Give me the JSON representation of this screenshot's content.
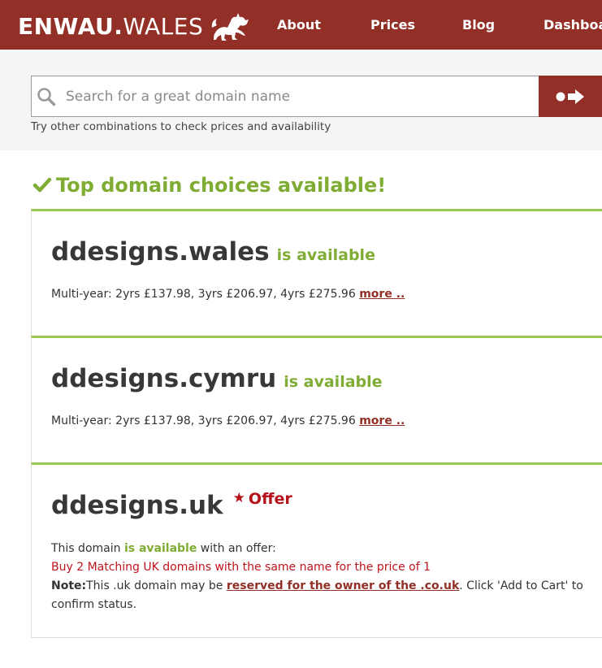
{
  "header": {
    "logo_bold": "ENWAU.",
    "logo_light": "WALES",
    "nav": [
      "About",
      "Prices",
      "Blog",
      "Dashboard"
    ]
  },
  "search": {
    "placeholder": "Search for a great domain name",
    "value": "",
    "hint": "Try other combinations to check prices and availability"
  },
  "results": {
    "heading": "Top domain choices available!",
    "cards": [
      {
        "domain": "ddesigns.wales",
        "status": "is available",
        "price_text": "Multi-year: 2yrs £137.98, 3yrs £206.97, 4yrs £275.96 ",
        "more_label": "more .."
      },
      {
        "domain": "ddesigns.cymru",
        "status": "is available",
        "price_text": "Multi-year: 2yrs £137.98, 3yrs £206.97, 4yrs £275.96 ",
        "more_label": "more .."
      },
      {
        "domain": "ddesigns.uk",
        "offer_label": "Offer",
        "line1_pre": "This domain ",
        "line1_avail": "is available",
        "line1_post": " with an offer:",
        "offer_text": "Buy 2 Matching UK domains with the same name for the price of 1",
        "note_label": "Note:",
        "note_pre": "This .uk domain may be ",
        "note_link": "reserved for the owner of the .co.uk",
        "note_post": ". Click 'Add to Cart' to confirm status."
      }
    ]
  },
  "colors": {
    "brand": "#923027",
    "available_green": "#7fac33",
    "card_border_green": "#9bc952",
    "offer_red": "#b5121b"
  }
}
